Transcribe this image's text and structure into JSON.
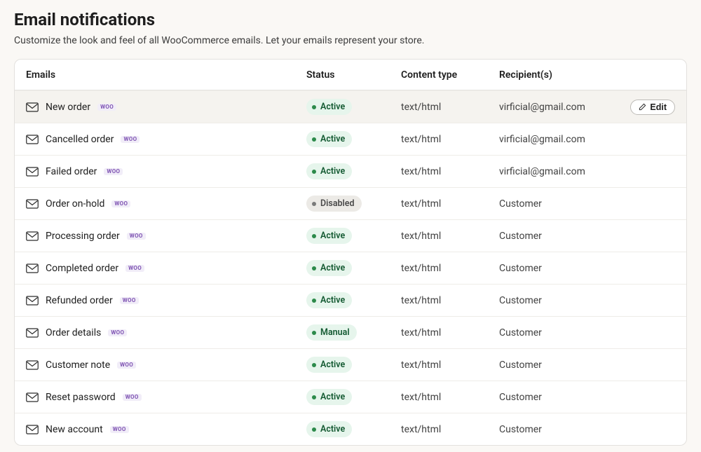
{
  "title": "Email notifications",
  "subtitle": "Customize the look and feel of all WooCommerce emails. Let your emails represent your store.",
  "columns": {
    "emails": "Emails",
    "status": "Status",
    "content_type": "Content type",
    "recipients": "Recipient(s)"
  },
  "actions": {
    "edit": "Edit"
  },
  "tag_label": "WOO",
  "rows": [
    {
      "name": "New order",
      "status": "Active",
      "status_kind": "active",
      "content_type": "text/html",
      "recipient": "virficial@gmail.com",
      "hovered": true,
      "show_edit": true
    },
    {
      "name": "Cancelled order",
      "status": "Active",
      "status_kind": "active",
      "content_type": "text/html",
      "recipient": "virficial@gmail.com",
      "hovered": false,
      "show_edit": false
    },
    {
      "name": "Failed order",
      "status": "Active",
      "status_kind": "active",
      "content_type": "text/html",
      "recipient": "virficial@gmail.com",
      "hovered": false,
      "show_edit": false
    },
    {
      "name": "Order on-hold",
      "status": "Disabled",
      "status_kind": "disabled",
      "content_type": "text/html",
      "recipient": "Customer",
      "hovered": false,
      "show_edit": false
    },
    {
      "name": "Processing order",
      "status": "Active",
      "status_kind": "active",
      "content_type": "text/html",
      "recipient": "Customer",
      "hovered": false,
      "show_edit": false
    },
    {
      "name": "Completed order",
      "status": "Active",
      "status_kind": "active",
      "content_type": "text/html",
      "recipient": "Customer",
      "hovered": false,
      "show_edit": false
    },
    {
      "name": "Refunded order",
      "status": "Active",
      "status_kind": "active",
      "content_type": "text/html",
      "recipient": "Customer",
      "hovered": false,
      "show_edit": false
    },
    {
      "name": "Order details",
      "status": "Manual",
      "status_kind": "manual",
      "content_type": "text/html",
      "recipient": "Customer",
      "hovered": false,
      "show_edit": false
    },
    {
      "name": "Customer note",
      "status": "Active",
      "status_kind": "active",
      "content_type": "text/html",
      "recipient": "Customer",
      "hovered": false,
      "show_edit": false
    },
    {
      "name": "Reset password",
      "status": "Active",
      "status_kind": "active",
      "content_type": "text/html",
      "recipient": "Customer",
      "hovered": false,
      "show_edit": false
    },
    {
      "name": "New account",
      "status": "Active",
      "status_kind": "active",
      "content_type": "text/html",
      "recipient": "Customer",
      "hovered": false,
      "show_edit": false
    }
  ]
}
